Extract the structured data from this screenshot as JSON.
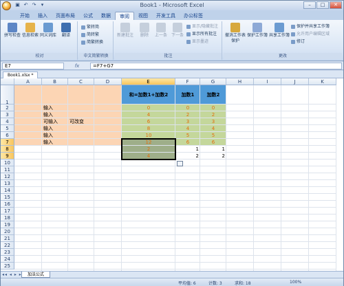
{
  "app": {
    "title": "Book1 - Microsoft Excel",
    "tabs": [
      "开始",
      "插入",
      "页面布局",
      "公式",
      "数据",
      "审阅",
      "视图",
      "开发工具",
      "办公标签"
    ],
    "active_tab": "审阅"
  },
  "ribbon": {
    "groups": [
      {
        "label": "校对",
        "buttons": [
          "拼写检查",
          "信息检索",
          "同义词库",
          "翻译"
        ]
      },
      {
        "label": "中文简繁转换",
        "buttons": [
          "繁转简",
          "简转繁",
          "简繁转换"
        ]
      },
      {
        "label": "批注",
        "buttons": [
          "新建批注",
          "删除",
          "上一条",
          "下一条"
        ],
        "small": [
          "显示/隐藏批注",
          "显示所有批注",
          "显示墨迹"
        ]
      },
      {
        "label": "更改",
        "buttons": [
          "撤消工作表保护",
          "保护工作簿",
          "共享工作簿"
        ],
        "small": [
          "保护并共享工作簿",
          "允许用户编辑区域",
          "修订"
        ]
      }
    ]
  },
  "formula_bar": {
    "name_box": "E7",
    "fx": "fx",
    "formula": "=F7+G7"
  },
  "doc_tab": "Book1.xlsx *",
  "columns": [
    "A",
    "B",
    "C",
    "D",
    "E",
    "F",
    "G",
    "H",
    "I",
    "J",
    "K"
  ],
  "rows": [
    "1",
    "2",
    "3",
    "4",
    "5",
    "6",
    "7",
    "8",
    "9",
    "10",
    "11",
    "12",
    "13",
    "14",
    "15",
    "16",
    "17",
    "18",
    "19",
    "20",
    "21",
    "22",
    "23",
    "24",
    "25"
  ],
  "cells": {
    "E1": "和=加数1+加数2",
    "F1": "加数1",
    "G1": "加数2",
    "B2": "输入",
    "B3": "输入",
    "B4": "可输入",
    "C4": "可改变",
    "B5": "输入",
    "B6": "输入",
    "B7": "输入",
    "E_values": [
      "0",
      "4",
      "6",
      "8",
      "10",
      "12",
      "2",
      "4"
    ],
    "F_values": [
      "0",
      "2",
      "3",
      "4",
      "5",
      "6",
      "1",
      "2"
    ],
    "G_values": [
      "0",
      "2",
      "3",
      "4",
      "5",
      "6",
      "1",
      "2"
    ]
  },
  "sheet_tab": "加法公式",
  "status": {
    "average": "平均值: 6",
    "count": "计数: 3",
    "sum": "求和: 18",
    "zoom": "100%"
  },
  "colors": {
    "peach": "#fcd5b4",
    "green": "#c4d79b",
    "blue_header": "#4f9ad8",
    "orange_text": "#e36c0a"
  }
}
